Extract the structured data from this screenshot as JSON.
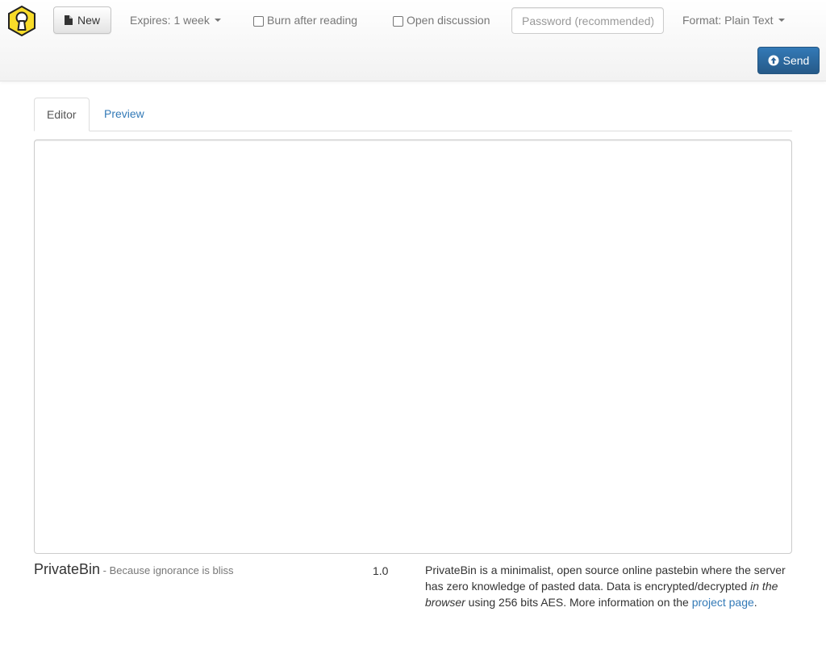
{
  "navbar": {
    "new_label": "New",
    "expires_label": "Expires: 1 week",
    "burn_label": "Burn after reading",
    "discussion_label": "Open discussion",
    "password_placeholder": "Password (recommended)",
    "format_label": "Format: Plain Text",
    "send_label": "Send"
  },
  "tabs": {
    "editor_label": "Editor",
    "preview_label": "Preview"
  },
  "editor": {
    "value": ""
  },
  "footer": {
    "app_name": "PrivateBin",
    "tagline": " - Because ignorance is bliss",
    "version": "1.0",
    "about_part1": "PrivateBin is a minimalist, open source online pastebin where the server has zero knowledge of pasted data. Data is encrypted/decrypted ",
    "about_italic": "in the browser",
    "about_part2": " using 256 bits AES. More information on the ",
    "project_link": "project page",
    "about_end": "."
  },
  "colors": {
    "logo_fill": "#f8dc29",
    "link": "#337ab7",
    "primary": "#286090"
  },
  "icons": {
    "logo": "keyhole-shield-icon",
    "new": "file-icon",
    "send": "circle-arrow-up-icon"
  }
}
